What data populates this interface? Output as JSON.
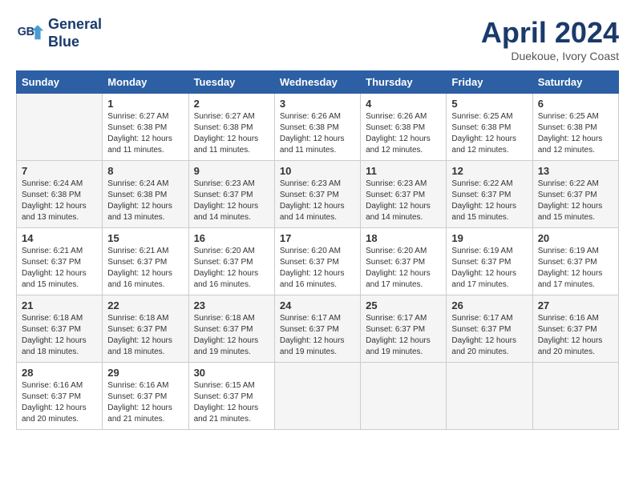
{
  "header": {
    "logo_line1": "General",
    "logo_line2": "Blue",
    "month": "April 2024",
    "location": "Duekoue, Ivory Coast"
  },
  "days_of_week": [
    "Sunday",
    "Monday",
    "Tuesday",
    "Wednesday",
    "Thursday",
    "Friday",
    "Saturday"
  ],
  "weeks": [
    [
      {
        "day": "",
        "info": ""
      },
      {
        "day": "1",
        "info": "Sunrise: 6:27 AM\nSunset: 6:38 PM\nDaylight: 12 hours\nand 11 minutes."
      },
      {
        "day": "2",
        "info": "Sunrise: 6:27 AM\nSunset: 6:38 PM\nDaylight: 12 hours\nand 11 minutes."
      },
      {
        "day": "3",
        "info": "Sunrise: 6:26 AM\nSunset: 6:38 PM\nDaylight: 12 hours\nand 11 minutes."
      },
      {
        "day": "4",
        "info": "Sunrise: 6:26 AM\nSunset: 6:38 PM\nDaylight: 12 hours\nand 12 minutes."
      },
      {
        "day": "5",
        "info": "Sunrise: 6:25 AM\nSunset: 6:38 PM\nDaylight: 12 hours\nand 12 minutes."
      },
      {
        "day": "6",
        "info": "Sunrise: 6:25 AM\nSunset: 6:38 PM\nDaylight: 12 hours\nand 12 minutes."
      }
    ],
    [
      {
        "day": "7",
        "info": "Sunrise: 6:24 AM\nSunset: 6:38 PM\nDaylight: 12 hours\nand 13 minutes."
      },
      {
        "day": "8",
        "info": "Sunrise: 6:24 AM\nSunset: 6:38 PM\nDaylight: 12 hours\nand 13 minutes."
      },
      {
        "day": "9",
        "info": "Sunrise: 6:23 AM\nSunset: 6:37 PM\nDaylight: 12 hours\nand 14 minutes."
      },
      {
        "day": "10",
        "info": "Sunrise: 6:23 AM\nSunset: 6:37 PM\nDaylight: 12 hours\nand 14 minutes."
      },
      {
        "day": "11",
        "info": "Sunrise: 6:23 AM\nSunset: 6:37 PM\nDaylight: 12 hours\nand 14 minutes."
      },
      {
        "day": "12",
        "info": "Sunrise: 6:22 AM\nSunset: 6:37 PM\nDaylight: 12 hours\nand 15 minutes."
      },
      {
        "day": "13",
        "info": "Sunrise: 6:22 AM\nSunset: 6:37 PM\nDaylight: 12 hours\nand 15 minutes."
      }
    ],
    [
      {
        "day": "14",
        "info": "Sunrise: 6:21 AM\nSunset: 6:37 PM\nDaylight: 12 hours\nand 15 minutes."
      },
      {
        "day": "15",
        "info": "Sunrise: 6:21 AM\nSunset: 6:37 PM\nDaylight: 12 hours\nand 16 minutes."
      },
      {
        "day": "16",
        "info": "Sunrise: 6:20 AM\nSunset: 6:37 PM\nDaylight: 12 hours\nand 16 minutes."
      },
      {
        "day": "17",
        "info": "Sunrise: 6:20 AM\nSunset: 6:37 PM\nDaylight: 12 hours\nand 16 minutes."
      },
      {
        "day": "18",
        "info": "Sunrise: 6:20 AM\nSunset: 6:37 PM\nDaylight: 12 hours\nand 17 minutes."
      },
      {
        "day": "19",
        "info": "Sunrise: 6:19 AM\nSunset: 6:37 PM\nDaylight: 12 hours\nand 17 minutes."
      },
      {
        "day": "20",
        "info": "Sunrise: 6:19 AM\nSunset: 6:37 PM\nDaylight: 12 hours\nand 17 minutes."
      }
    ],
    [
      {
        "day": "21",
        "info": "Sunrise: 6:18 AM\nSunset: 6:37 PM\nDaylight: 12 hours\nand 18 minutes."
      },
      {
        "day": "22",
        "info": "Sunrise: 6:18 AM\nSunset: 6:37 PM\nDaylight: 12 hours\nand 18 minutes."
      },
      {
        "day": "23",
        "info": "Sunrise: 6:18 AM\nSunset: 6:37 PM\nDaylight: 12 hours\nand 19 minutes."
      },
      {
        "day": "24",
        "info": "Sunrise: 6:17 AM\nSunset: 6:37 PM\nDaylight: 12 hours\nand 19 minutes."
      },
      {
        "day": "25",
        "info": "Sunrise: 6:17 AM\nSunset: 6:37 PM\nDaylight: 12 hours\nand 19 minutes."
      },
      {
        "day": "26",
        "info": "Sunrise: 6:17 AM\nSunset: 6:37 PM\nDaylight: 12 hours\nand 20 minutes."
      },
      {
        "day": "27",
        "info": "Sunrise: 6:16 AM\nSunset: 6:37 PM\nDaylight: 12 hours\nand 20 minutes."
      }
    ],
    [
      {
        "day": "28",
        "info": "Sunrise: 6:16 AM\nSunset: 6:37 PM\nDaylight: 12 hours\nand 20 minutes."
      },
      {
        "day": "29",
        "info": "Sunrise: 6:16 AM\nSunset: 6:37 PM\nDaylight: 12 hours\nand 21 minutes."
      },
      {
        "day": "30",
        "info": "Sunrise: 6:15 AM\nSunset: 6:37 PM\nDaylight: 12 hours\nand 21 minutes."
      },
      {
        "day": "",
        "info": ""
      },
      {
        "day": "",
        "info": ""
      },
      {
        "day": "",
        "info": ""
      },
      {
        "day": "",
        "info": ""
      }
    ]
  ]
}
